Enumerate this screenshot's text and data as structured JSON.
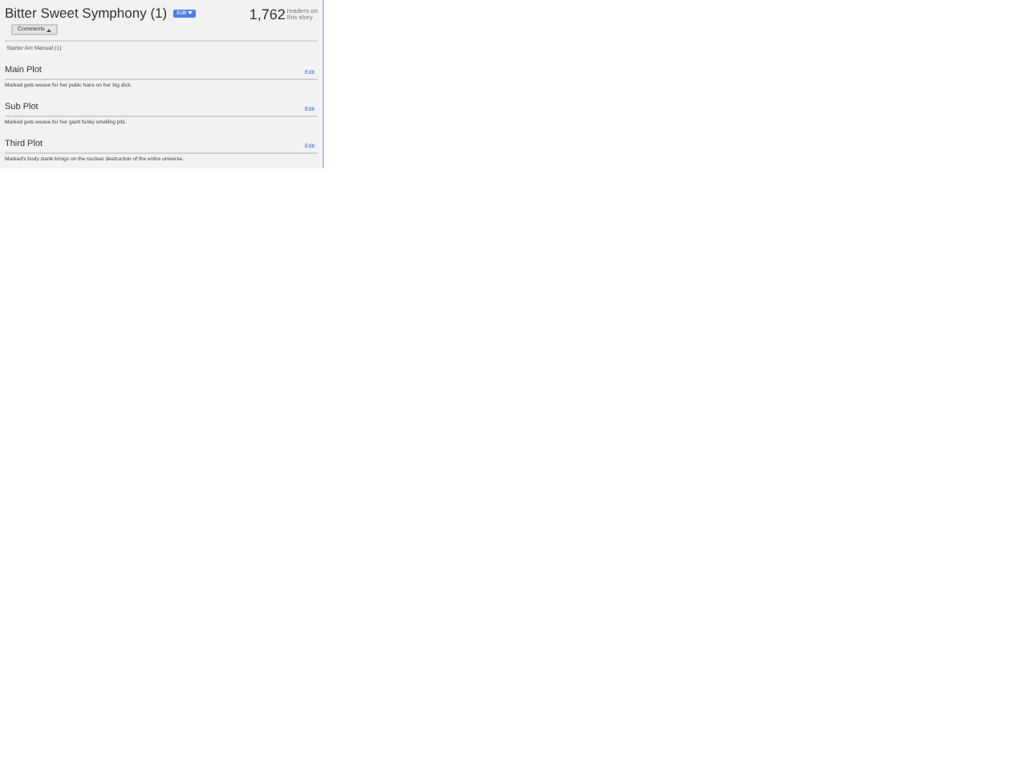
{
  "header": {
    "title": "Bitter Sweet Symphony (1)",
    "edit_button": "Edit",
    "count": "1,762",
    "count_caption_1": "readers on",
    "count_caption_2": "this story",
    "comments_button": "Comments"
  },
  "arc": "Starter Arc Manual (1)",
  "sections": [
    {
      "title": "Main Plot",
      "edit": "Edit",
      "text": "Marked gets weave for her pubic hairs on her big dick."
    },
    {
      "title": "Sub Plot",
      "edit": "Edit",
      "text": "Marked gets weave for her giant funky smelling pits."
    },
    {
      "title": "Third Plot",
      "edit": "Edit",
      "text": "Marked's body stank brings on the nuclear destruction of the entire universe."
    }
  ]
}
